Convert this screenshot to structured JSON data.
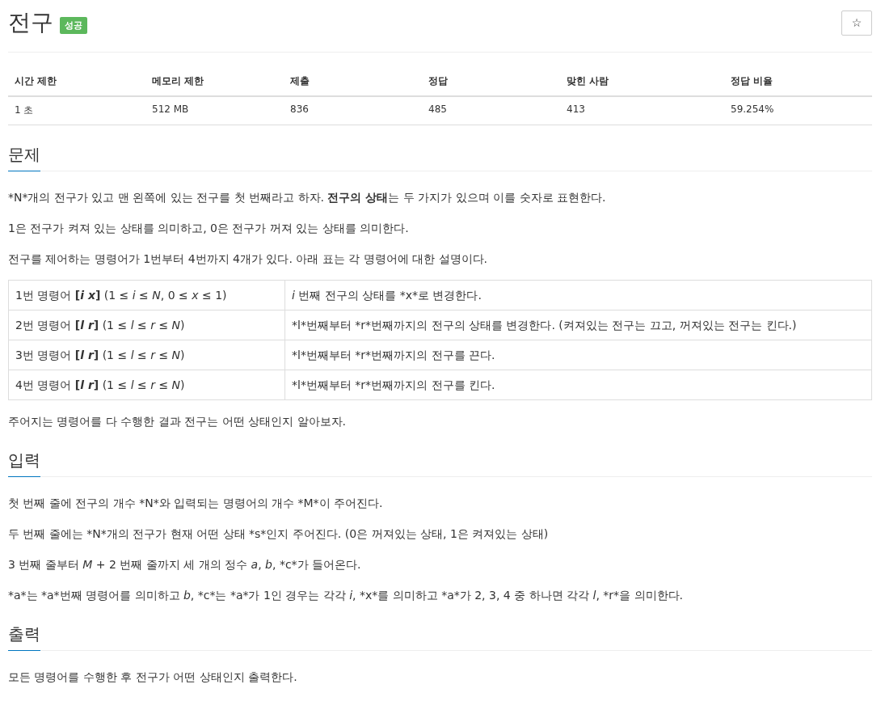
{
  "problem": {
    "title": "전구",
    "result_badge": "성공",
    "favorite_button": "☆"
  },
  "stats": {
    "columns": [
      "시간 제한",
      "메모리 제한",
      "제출",
      "정답",
      "맞힌 사람",
      "정답 비율"
    ],
    "row": [
      "1 초",
      "512 MB",
      "836",
      "485",
      "413",
      "59.254%"
    ]
  },
  "sections": [
    {
      "heading": "문제",
      "blocks": [
        {
          "kind": "paragraph",
          "text": "*N*개의 전구가 있고 맨 왼쪽에 있는 전구를 첫 번째라고 하자. **전구의 상태**는 두 가지가 있으며 이를 숫자로 표현한다."
        },
        {
          "kind": "paragraph",
          "text": "1은 전구가 켜져 있는 상태를 의미하고, 0은 전구가 꺼져 있는 상태를 의미한다."
        },
        {
          "kind": "paragraph",
          "text": "전구를 제어하는 명령어가 1번부터 4번까지 4개가 있다. 아래 표는 각 명령어에 대한 설명이다."
        },
        {
          "kind": "table",
          "rows": [
            [
              "1번 명령어 **[*i x*]** (1 ≤ *i* ≤ *N*, 0 ≤ *x* ≤ 1)",
              "*i* 번째 전구의 상태를 *x*로 변경한다."
            ],
            [
              "2번 명령어 **[*l r*]** (1 ≤ *l* ≤ *r* ≤ *N*)",
              "*l*번째부터 *r*번째까지의 전구의 상태를 변경한다. (켜져있는 전구는 끄고, 꺼져있는 전구는 킨다.)"
            ],
            [
              "3번 명령어 **[*l r*]** (1 ≤ *l* ≤ *r* ≤ *N*)",
              "*l*번째부터 *r*번째까지의 전구를 끈다."
            ],
            [
              "4번 명령어 **[*l r*]** (1 ≤ *l* ≤ *r* ≤ *N*)",
              "*l*번째부터 *r*번째까지의 전구를 킨다."
            ]
          ]
        },
        {
          "kind": "paragraph",
          "text": "주어지는 명령어를 다 수행한 결과 전구는 어떤 상태인지 알아보자."
        }
      ]
    },
    {
      "heading": "입력",
      "blocks": [
        {
          "kind": "paragraph",
          "text": "첫 번째 줄에 전구의 개수 *N*와 입력되는 명령어의 개수 *M*이 주어진다."
        },
        {
          "kind": "paragraph",
          "text": "두 번째 줄에는 *N*개의 전구가 현재 어떤 상태 *s*인지 주어진다. (0은 꺼져있는 상태, 1은 켜져있는 상태)"
        },
        {
          "kind": "paragraph",
          "text": "3 번째 줄부터 *M* + 2 번째 줄까지 세 개의 정수 *a*, *b*, *c*가 들어온다."
        },
        {
          "kind": "paragraph",
          "text": "*a*는 *a*번째 명령어를 의미하고 *b*, *c*는 *a*가 1인 경우는 각각 *i*, *x*를 의미하고 *a*가 2, 3, 4 중 하나면 각각 *l*, *r*을 의미한다."
        }
      ]
    },
    {
      "heading": "출력",
      "blocks": [
        {
          "kind": "paragraph",
          "text": "모든 명령어를 수행한 후 전구가 어떤 상태인지 출력한다."
        }
      ]
    }
  ]
}
